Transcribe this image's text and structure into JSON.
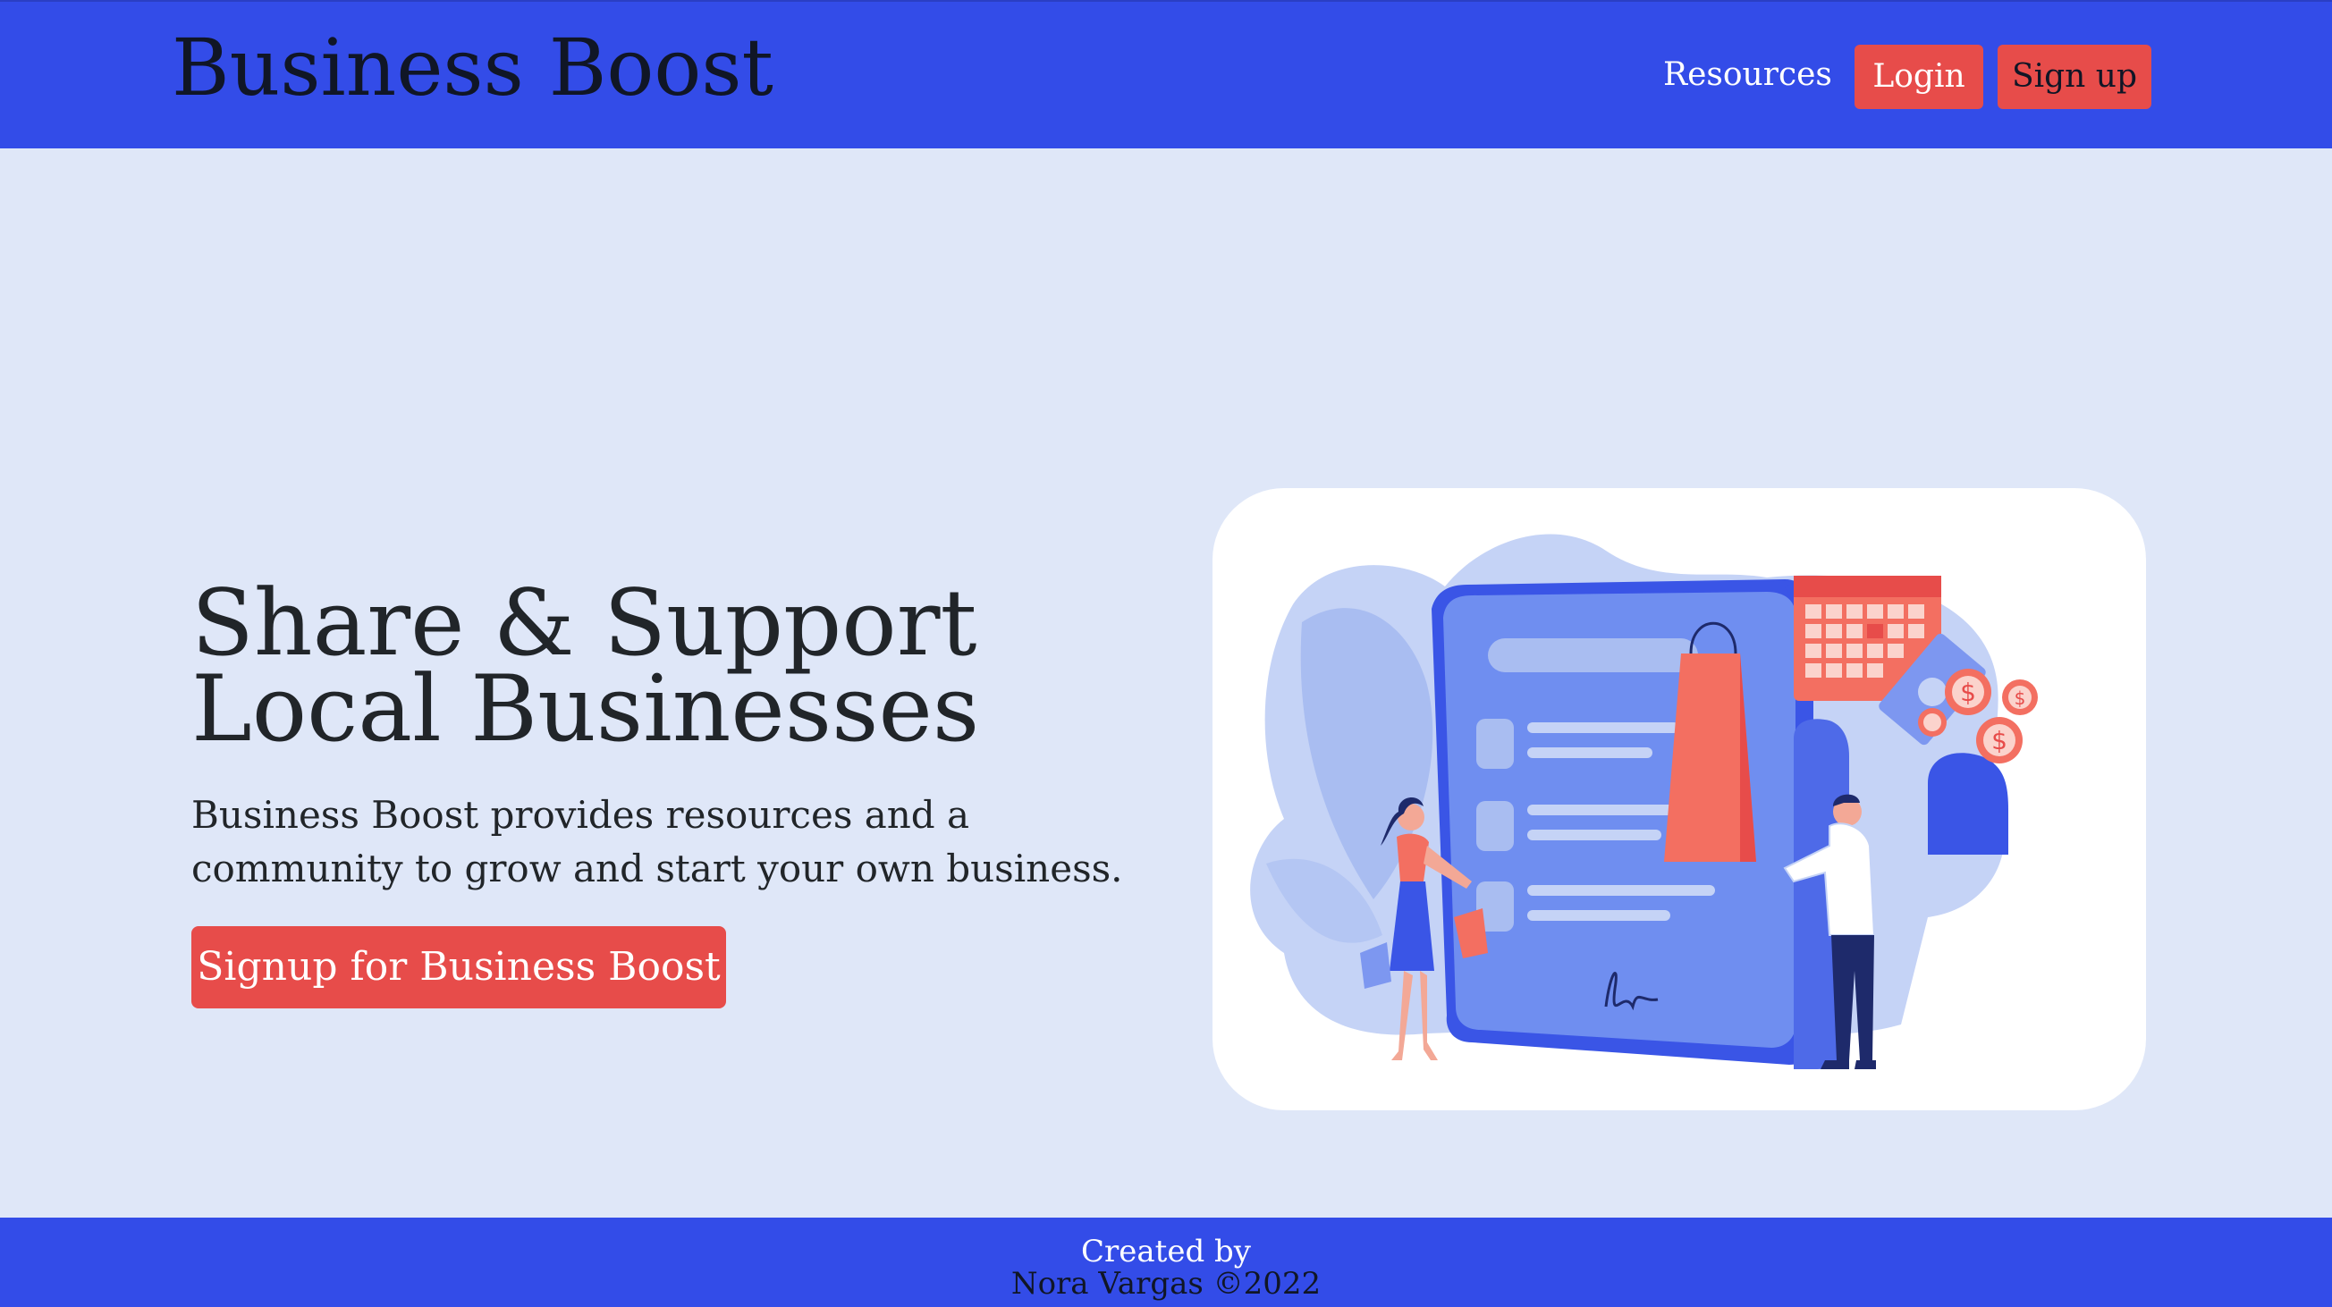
{
  "navbar": {
    "brand": "Business Boost",
    "links": {
      "resources": "Resources"
    },
    "buttons": {
      "login": "Login",
      "signup": "Sign up"
    }
  },
  "hero": {
    "title_line1": "Share & Support",
    "title_line2": "Local Businesses",
    "text_line1": "Business Boost provides resources and a",
    "text_line2": "community to grow and start your own business.",
    "cta_label": "Signup for Business Boost"
  },
  "footer": {
    "line1": "Created by",
    "line2": "Nora Vargas ©2022"
  },
  "colors": {
    "primary": "#334ce8",
    "accent": "#e74c4a",
    "background": "#dfe7f8"
  },
  "icons": [
    "shopping-bag-icon",
    "calendar-icon",
    "dollar-coin-icon",
    "banknote-icon",
    "document-icon"
  ]
}
